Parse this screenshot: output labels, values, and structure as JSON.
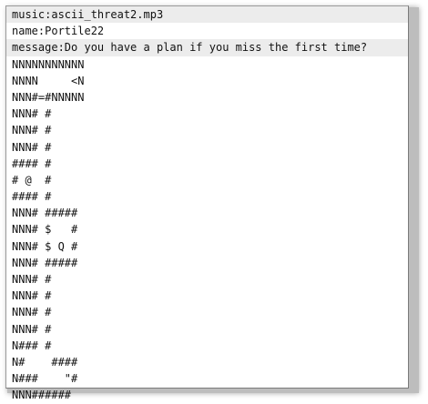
{
  "header": {
    "music": "music:ascii_threat2.mp3",
    "name": "name:Portile22",
    "message": "message:Do you have a plan if you miss the first time?"
  },
  "map_lines": [
    "NNNNNNNNNNN",
    "NNNN     <N",
    "NNN#=#NNNNN",
    "NNN# #",
    "NNN# #",
    "NNN# #",
    "#### #",
    "# @  #",
    "#### #",
    "NNN# #####",
    "NNN# $   #",
    "NNN# $ Q #",
    "NNN# #####",
    "NNN# #",
    "NNN# #",
    "NNN# #",
    "NNN# #",
    "N### #",
    "N#    ####",
    "N###    \"#",
    "NNN######"
  ]
}
